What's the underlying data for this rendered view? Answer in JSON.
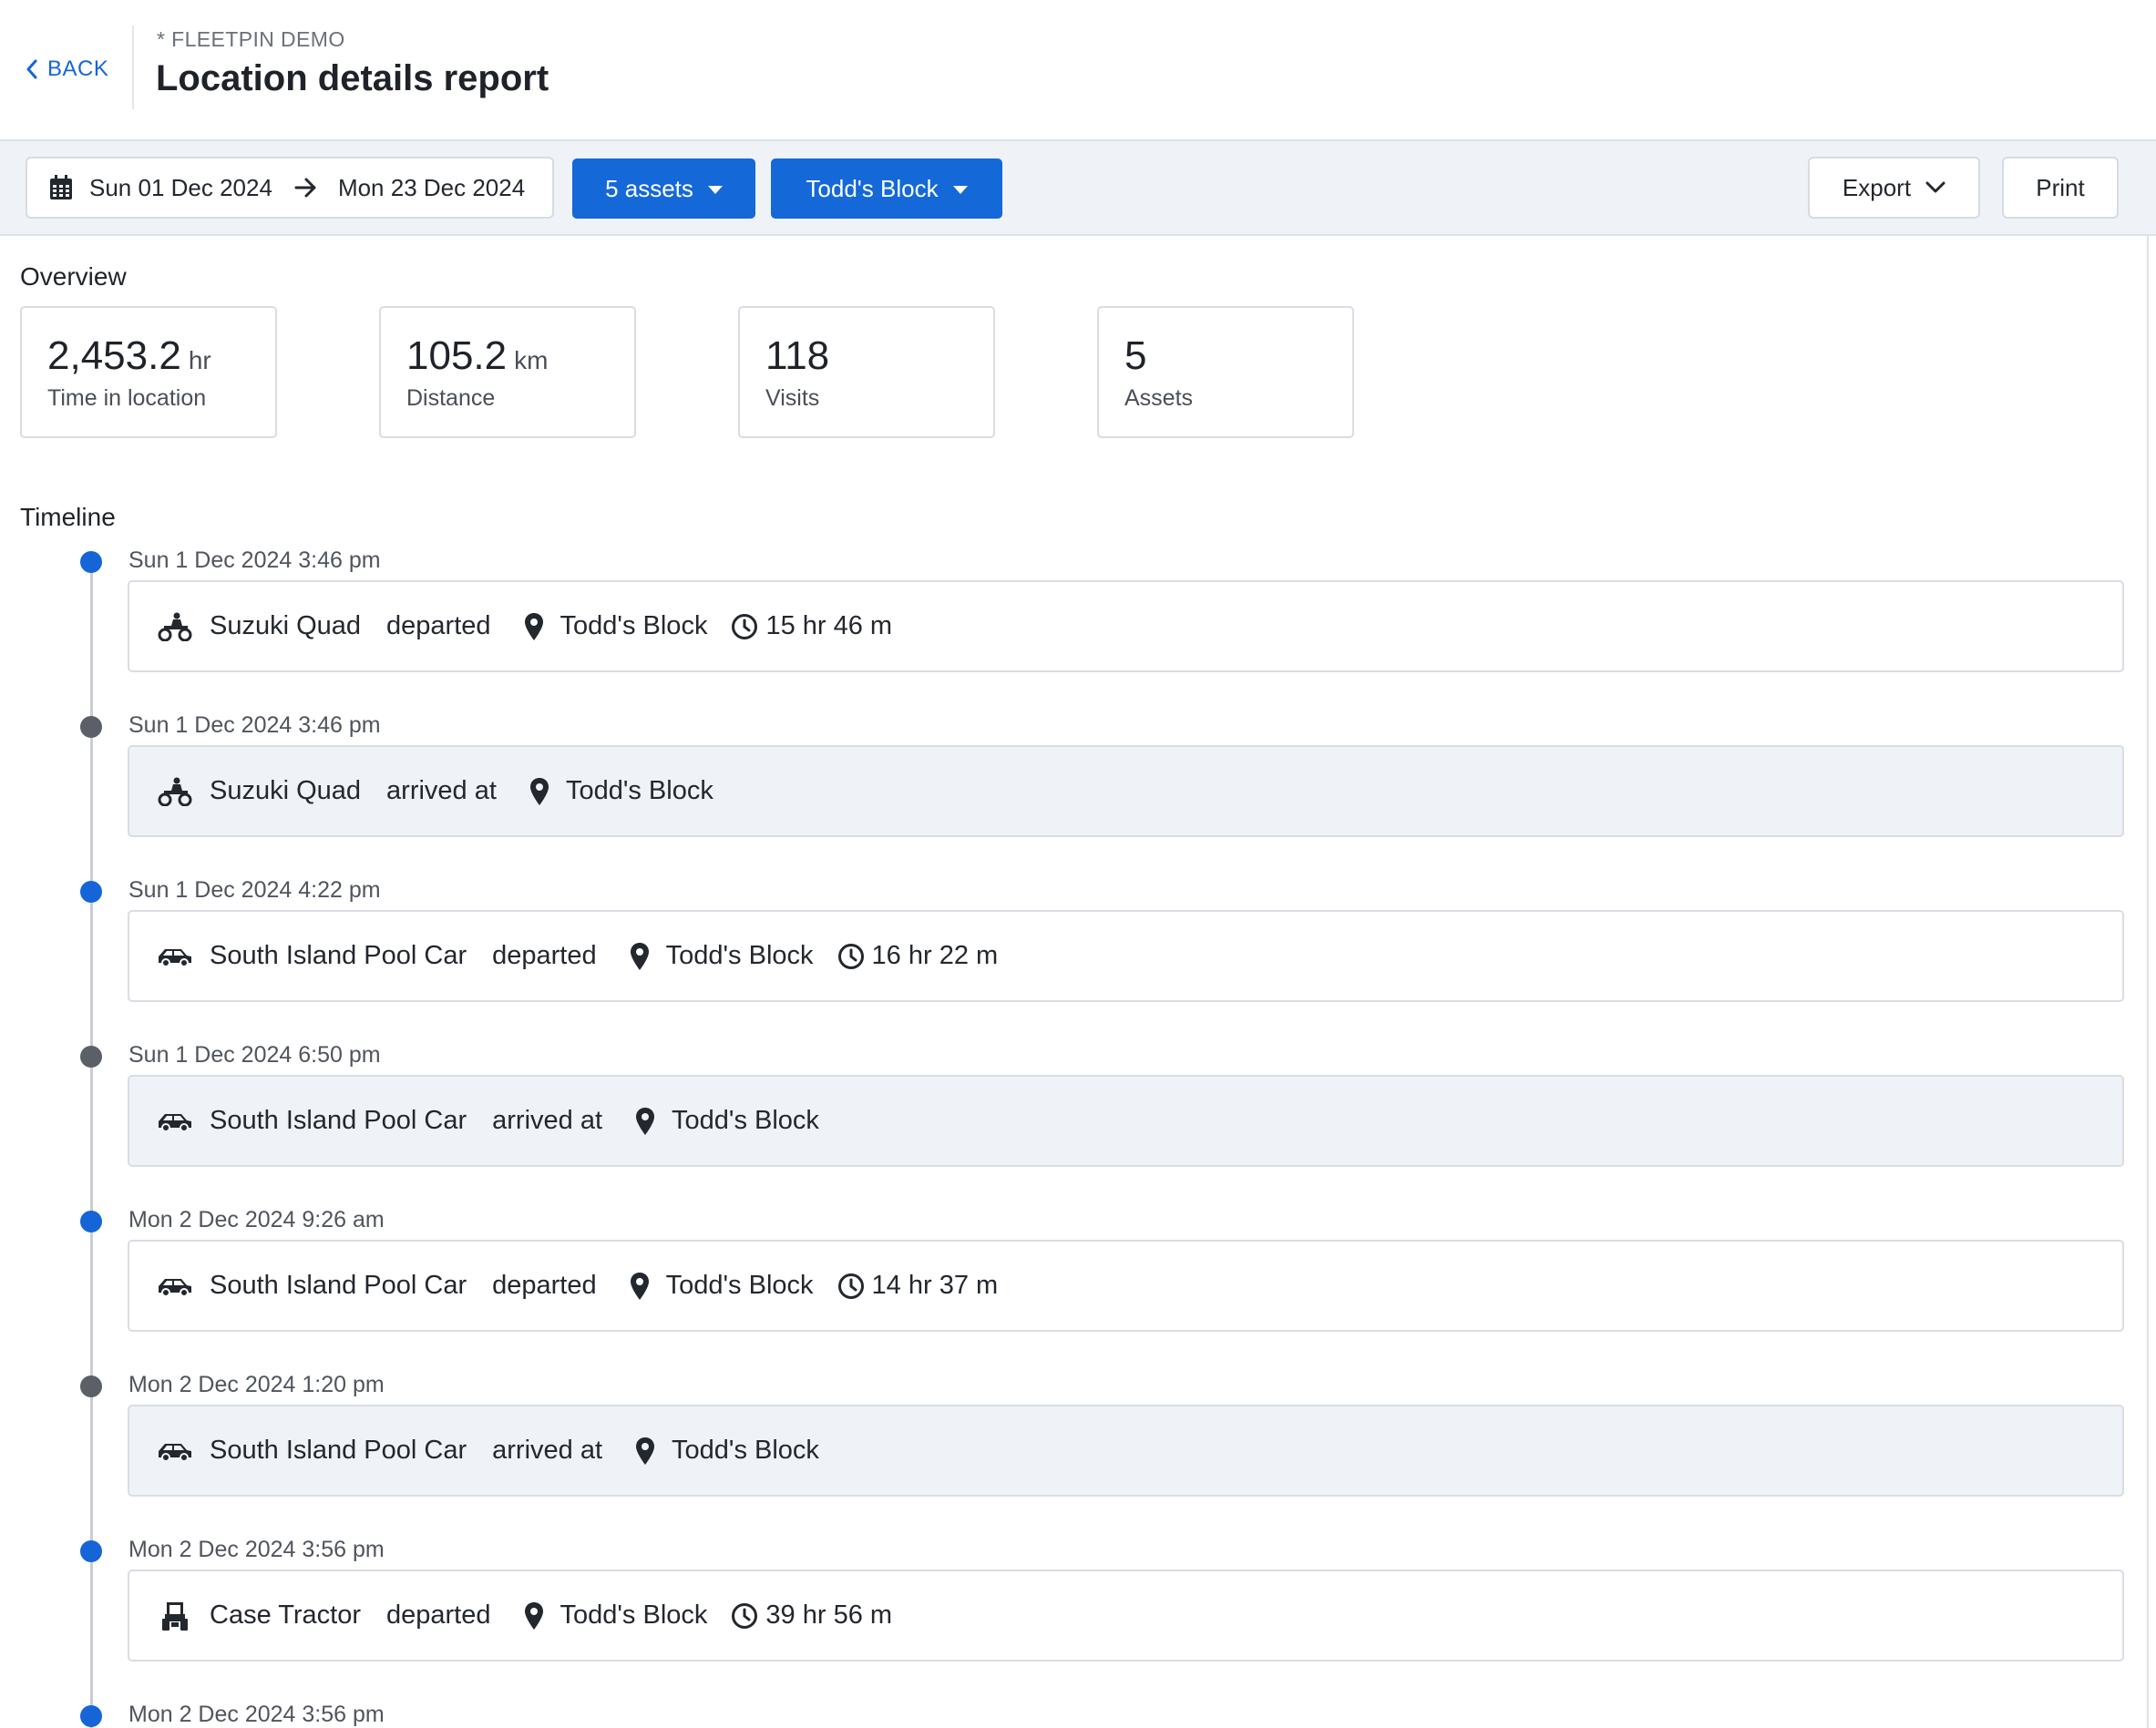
{
  "header": {
    "back_label": "BACK",
    "org": "* FLEETPIN DEMO",
    "title": "Location details report"
  },
  "toolbar": {
    "date_from": "Sun 01 Dec 2024",
    "date_to": "Mon 23 Dec 2024",
    "assets_button": "5 assets",
    "location_button": "Todd's Block",
    "export_button": "Export",
    "print_button": "Print"
  },
  "overview": {
    "label": "Overview",
    "stats": [
      {
        "value": "2,453.2",
        "unit": "hr",
        "label": "Time in location"
      },
      {
        "value": "105.2",
        "unit": "km",
        "label": "Distance"
      },
      {
        "value": "118",
        "unit": "",
        "label": "Visits"
      },
      {
        "value": "5",
        "unit": "",
        "label": "Assets"
      }
    ]
  },
  "timeline": {
    "label": "Timeline",
    "events": [
      {
        "time": "Sun 1 Dec 2024 3:46 pm",
        "asset": "Suzuki Quad",
        "asset_icon": "quad-bike-icon",
        "action": "departed",
        "location": "Todd's Block",
        "duration": "15 hr 46 m"
      },
      {
        "time": "Sun 1 Dec 2024 3:46 pm",
        "asset": "Suzuki Quad",
        "asset_icon": "quad-bike-icon",
        "action": "arrived at",
        "location": "Todd's Block",
        "duration": ""
      },
      {
        "time": "Sun 1 Dec 2024 4:22 pm",
        "asset": "South Island Pool Car",
        "asset_icon": "car-icon",
        "action": "departed",
        "location": "Todd's Block",
        "duration": "16 hr 22 m"
      },
      {
        "time": "Sun 1 Dec 2024 6:50 pm",
        "asset": "South Island Pool Car",
        "asset_icon": "car-icon",
        "action": "arrived at",
        "location": "Todd's Block",
        "duration": ""
      },
      {
        "time": "Mon 2 Dec 2024 9:26 am",
        "asset": "South Island Pool Car",
        "asset_icon": "car-icon",
        "action": "departed",
        "location": "Todd's Block",
        "duration": "14 hr 37 m"
      },
      {
        "time": "Mon 2 Dec 2024 1:20 pm",
        "asset": "South Island Pool Car",
        "asset_icon": "car-icon",
        "action": "arrived at",
        "location": "Todd's Block",
        "duration": ""
      },
      {
        "time": "Mon 2 Dec 2024 3:56 pm",
        "asset": "Case Tractor",
        "asset_icon": "tractor-icon",
        "action": "departed",
        "location": "Todd's Block",
        "duration": "39 hr 56 m"
      },
      {
        "time": "Mon 2 Dec 2024 3:56 pm",
        "asset": "",
        "asset_icon": "",
        "action": "",
        "location": "",
        "duration": ""
      }
    ]
  },
  "colors": {
    "accent": "#1565d8",
    "toolbar_bg": "#eff2f7",
    "arrived_bg": "#eff2f7",
    "departed_dot": "#1565d8",
    "arrived_dot": "#5b6068"
  }
}
